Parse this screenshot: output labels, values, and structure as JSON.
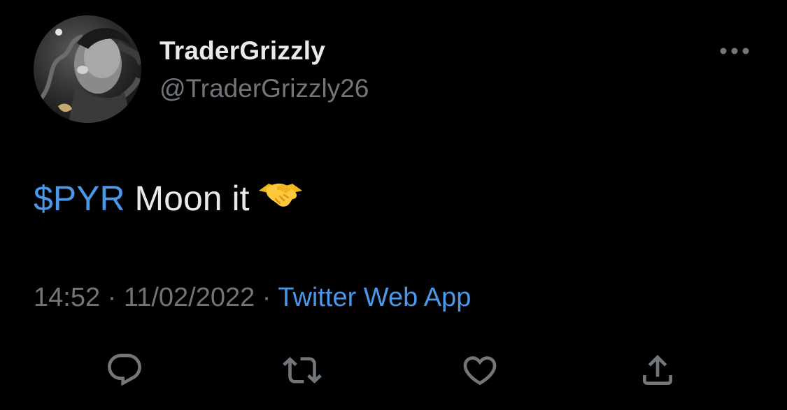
{
  "tweet": {
    "author": {
      "display_name": "TraderGrizzly",
      "handle": "@TraderGrizzly26"
    },
    "text": {
      "cashtag": "$PYR",
      "body": " Moon it",
      "emoji": "handshake-emoji"
    },
    "meta": {
      "time": "14:52",
      "separator": " · ",
      "date": "11/02/2022",
      "source": "Twitter Web App"
    },
    "actions": {
      "reply_icon": "reply-icon",
      "retweet_icon": "retweet-icon",
      "like_icon": "like-icon",
      "share_icon": "share-icon"
    },
    "more_icon": "more-icon"
  },
  "colors": {
    "background": "#000000",
    "primary_text": "#e7e9ea",
    "secondary_text": "#71767b",
    "link": "#4a99e9",
    "icon": "#71767b"
  }
}
